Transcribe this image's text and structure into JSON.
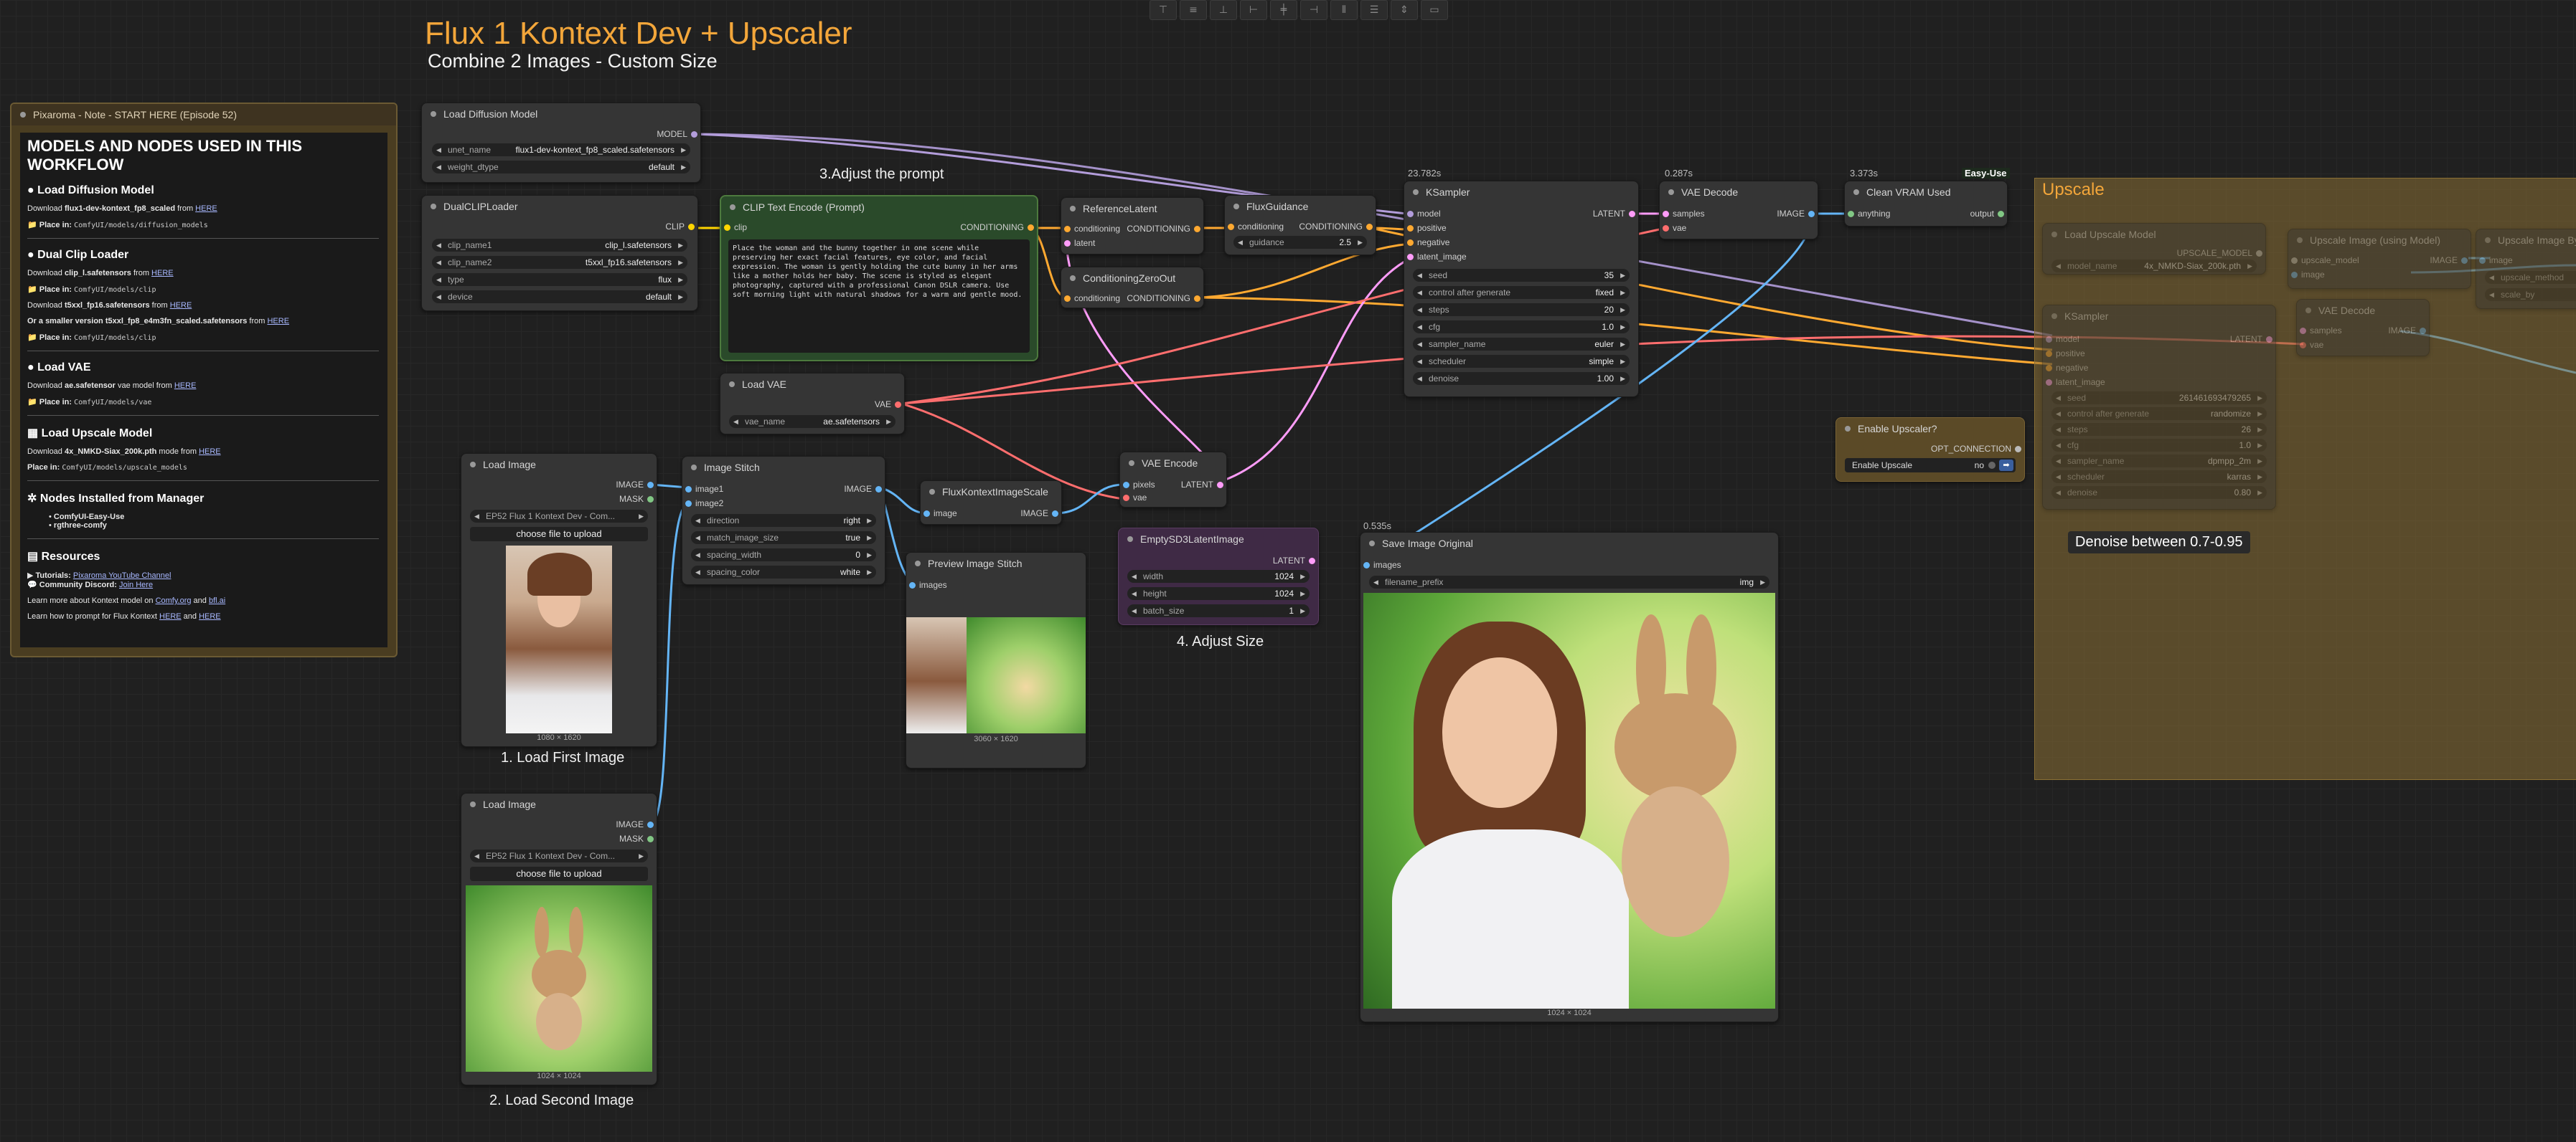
{
  "header": {
    "title": "Flux 1 Kontext Dev + Upscaler",
    "subtitle": "Combine 2 Images - Custom Size"
  },
  "toolbar": {
    "icons": [
      "align-top-icon",
      "align-middle-icon",
      "align-bottom-icon",
      "align-left-icon",
      "align-center-icon",
      "align-right-icon",
      "distribute-h-icon",
      "distribute-v-icon",
      "stretch-icon",
      "more-icon"
    ]
  },
  "captions": {
    "adjust_prompt": "3.Adjust the prompt",
    "load_first": "1. Load First Image",
    "load_second": "2. Load Second Image",
    "adjust_size": "4. Adjust Size",
    "denoise": "Denoise between 0.7-0.95"
  },
  "note": {
    "title": "Pixaroma - Note - START HERE (Episode 52)",
    "heading": "MODELS AND NODES USED IN THIS WORKFLOW",
    "s1_title": "Load Diffusion Model",
    "s1_prefix": "Download ",
    "s1_file": "flux1-dev-kontext_fp8_scaled",
    "s1_mid": " from ",
    "link": "HERE",
    "s1_place": "Place in:",
    "s1_path": "ComfyUI/models/diffusion_models",
    "s2_title": "Dual Clip Loader",
    "s2_prefix": "Download ",
    "s2_file": "clip_l.safetensors",
    "s2_place": "Place in:",
    "s2_path": "ComfyUI/models/clip",
    "s2b_file": "t5xxl_fp16.safetensors",
    "s2c_prefix": "Or a smaller version ",
    "s2c_file": "t5xxl_fp8_e4m3fn_scaled.safetensors",
    "s3_title": "Load VAE",
    "s3_file": "ae.safetensor",
    "s3_mid": " vae model from ",
    "s3_path": "ComfyUI/models/vae",
    "s4_title": "Load Upscale Model",
    "s4_file": "4x_NMKD-Siax_200k.pth",
    "s4_mid": " mode from ",
    "s4_path": "ComfyUI/models/upscale_models",
    "s5_title": "Nodes Installed from Manager",
    "s5_items": [
      "ComfyUI-Easy-Use",
      "rgthree-comfy"
    ],
    "s6_title": "Resources",
    "tutorials_label": "Tutorials: ",
    "tutorials_link": "Pixaroma YouTube Channel",
    "discord_label": "Community Discord: ",
    "discord_link": "Join Here",
    "learn1": "Learn more about Kontext model on ",
    "comfy": "Comfy.org",
    "and": " and ",
    "bfl": "bfl.ai",
    "learn2": "Learn how to prompt for Flux Kontext ",
    "here": "HERE",
    "and_here": " and "
  },
  "nodes": {
    "diffusion": {
      "title": "Load Diffusion Model",
      "out": "MODEL",
      "unet_label": "unet_name",
      "unet_value": "flux1-dev-kontext_fp8_scaled.safetensors",
      "dtype_label": "weight_dtype",
      "dtype_value": "default"
    },
    "dualclip": {
      "title": "DualCLIPLoader",
      "out": "CLIP",
      "c1_label": "clip_name1",
      "c1_value": "clip_l.safetensors",
      "c2_label": "clip_name2",
      "c2_value": "t5xxl_fp16.safetensors",
      "type_label": "type",
      "type_value": "flux",
      "device_label": "device",
      "device_value": "default"
    },
    "cliptext": {
      "title": "CLIP Text Encode (Prompt)",
      "in": "clip",
      "out": "CONDITIONING",
      "text": "Place the woman and the bunny together in one scene while preserving her exact facial features, eye color, and facial expression. The woman is gently holding the cute bunny in her arms like a mother holds her baby. The scene is styled as elegant photography, captured with a professional Canon DSLR camera. Use soft morning light with natural shadows for a warm and gentle mood."
    },
    "refl": {
      "title": "ReferenceLatent",
      "in1": "conditioning",
      "in2": "latent",
      "out": "CONDITIONING"
    },
    "fluxg": {
      "title": "FluxGuidance",
      "in": "conditioning",
      "out": "CONDITIONING",
      "g_label": "guidance",
      "g_value": "2.5"
    },
    "czero": {
      "title": "ConditioningZeroOut",
      "in": "conditioning",
      "out": "CONDITIONING"
    },
    "ksampler": {
      "badge": "23.782s",
      "title": "KSampler",
      "in": [
        "model",
        "positive",
        "negative",
        "latent_image"
      ],
      "out": "LATENT",
      "widgets": [
        {
          "l": "seed",
          "v": "35"
        },
        {
          "l": "control after generate",
          "v": "fixed"
        },
        {
          "l": "steps",
          "v": "20"
        },
        {
          "l": "cfg",
          "v": "1.0"
        },
        {
          "l": "sampler_name",
          "v": "euler"
        },
        {
          "l": "scheduler",
          "v": "simple"
        },
        {
          "l": "denoise",
          "v": "1.00"
        }
      ]
    },
    "vaedec": {
      "badge": "0.287s",
      "title": "VAE Decode",
      "in1": "samples",
      "in2": "vae",
      "out": "IMAGE"
    },
    "cleanvram": {
      "badge": "3.373s",
      "title": "Clean VRAM Used",
      "tag": "Easy-Use",
      "in": "anything",
      "out": "output"
    },
    "loadvae": {
      "title": "Load VAE",
      "out": "VAE",
      "l": "vae_name",
      "v": "ae.safetensors"
    },
    "loadimg1": {
      "title": "Load Image",
      "out1": "IMAGE",
      "out2": "MASK",
      "file": "EP52 Flux 1 Kontext Dev - Com...",
      "upload": "choose file to upload",
      "size": "1080 × 1620"
    },
    "loadimg2": {
      "title": "Load Image",
      "out1": "IMAGE",
      "out2": "MASK",
      "file": "EP52 Flux 1 Kontext Dev - Com...",
      "upload": "choose file to upload",
      "size": "1024 × 1024"
    },
    "stitch": {
      "title": "Image Stitch",
      "in1": "image1",
      "in2": "image2",
      "out": "IMAGE",
      "widgets": [
        {
          "l": "direction",
          "v": "right"
        },
        {
          "l": "match_image_size",
          "v": "true"
        },
        {
          "l": "spacing_width",
          "v": "0"
        },
        {
          "l": "spacing_color",
          "v": "white"
        }
      ]
    },
    "fkscale": {
      "title": "FluxKontextImageScale",
      "in": "image",
      "out": "IMAGE"
    },
    "preview": {
      "title": "Preview Image Stitch",
      "in": "images",
      "size": "3060 × 1620"
    },
    "vaeenc": {
      "title": "VAE Encode",
      "in1": "pixels",
      "in2": "vae",
      "out": "LATENT"
    },
    "emptylat": {
      "title": "EmptySD3LatentImage",
      "out": "LATENT",
      "widgets": [
        {
          "l": "width",
          "v": "1024"
        },
        {
          "l": "height",
          "v": "1024"
        },
        {
          "l": "batch_size",
          "v": "1"
        }
      ]
    },
    "save": {
      "badge": "0.535s",
      "title": "Save Image Original",
      "in": "images",
      "l": "filename_prefix",
      "v": "img",
      "size": "1024 × 1024"
    },
    "enableup": {
      "title": "Enable Upscaler?",
      "out": "OPT_CONNECTION",
      "l": "Enable Upscale",
      "v": "no"
    }
  },
  "group": {
    "title": "Upscale",
    "upmodel": {
      "title": "Load Upscale Model",
      "out": "UPSCALE_MODEL",
      "l": "model_name",
      "v": "4x_NMKD-Siax_200k.pth"
    },
    "upimg": {
      "title": "Upscale Image (using Model)",
      "in1": "upscale_model",
      "in2": "image",
      "out": "IMAGE"
    },
    "upby": {
      "title": "Upscale Image By",
      "in": "image",
      "w1": "upscale_method",
      "w2": "scale_by"
    },
    "ks2": {
      "title": "KSampler",
      "in": [
        "model",
        "positive",
        "negative",
        "latent_image"
      ],
      "out": "LATENT",
      "widgets": [
        {
          "l": "seed",
          "v": "261461693479265"
        },
        {
          "l": "control after generate",
          "v": "randomize"
        },
        {
          "l": "steps",
          "v": "26"
        },
        {
          "l": "cfg",
          "v": "1.0"
        },
        {
          "l": "sampler_name",
          "v": "dpmpp_2m"
        },
        {
          "l": "scheduler",
          "v": "karras"
        },
        {
          "l": "denoise",
          "v": "0.80"
        }
      ]
    },
    "vd2": {
      "title": "VAE Decode",
      "in1": "samples",
      "in2": "vae",
      "out": "IMAGE"
    }
  },
  "colors": {
    "model": "#b39ddb",
    "clip": "#ffd500",
    "conditioning": "#ffa931",
    "latent": "#ff9cf9",
    "vae": "#ff6e6e",
    "image": "#64b5f6",
    "mask": "#81c784"
  }
}
